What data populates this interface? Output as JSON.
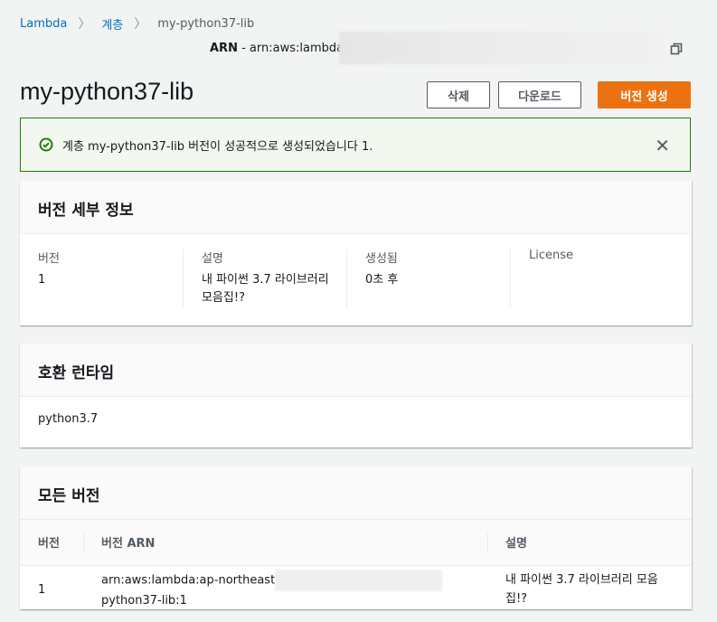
{
  "breadcrumb": [
    "Lambda",
    "계층",
    "my-python37-lib"
  ],
  "arn": {
    "label": "ARN",
    "value": "- arn:aws:lambda"
  },
  "title": "my-python37-lib",
  "buttons": {
    "delete": "삭제",
    "download": "다운로드",
    "create_version": "버전 생성"
  },
  "alert": {
    "message": "계층 my-python37-lib 버전이 성공적으로 생성되었습니다 1."
  },
  "details": {
    "title": "버전 세부 정보",
    "fields": [
      {
        "label": "버전",
        "value": "1"
      },
      {
        "label": "설명",
        "value": "내 파이썬 3.7 라이브러리 모음집!?"
      },
      {
        "label": "생성됨",
        "value": "0초 후"
      },
      {
        "label": "License",
        "value": ""
      }
    ]
  },
  "runtimes": {
    "title": "호환 런타임",
    "value": "python3.7"
  },
  "versions": {
    "title": "모든 버전",
    "columns": [
      "버전",
      "버전 ARN",
      "설명"
    ],
    "rows": [
      {
        "version": "1",
        "arn_start": "arn:aws:lambda:ap-northeast",
        "arn_end": "python37-lib:1",
        "description": "내 파이썬 3.7 라이브러리 모음집!?"
      }
    ]
  },
  "colors": {
    "primary": "#ec7211",
    "success": "#1d8102",
    "link": "#0073bb"
  }
}
